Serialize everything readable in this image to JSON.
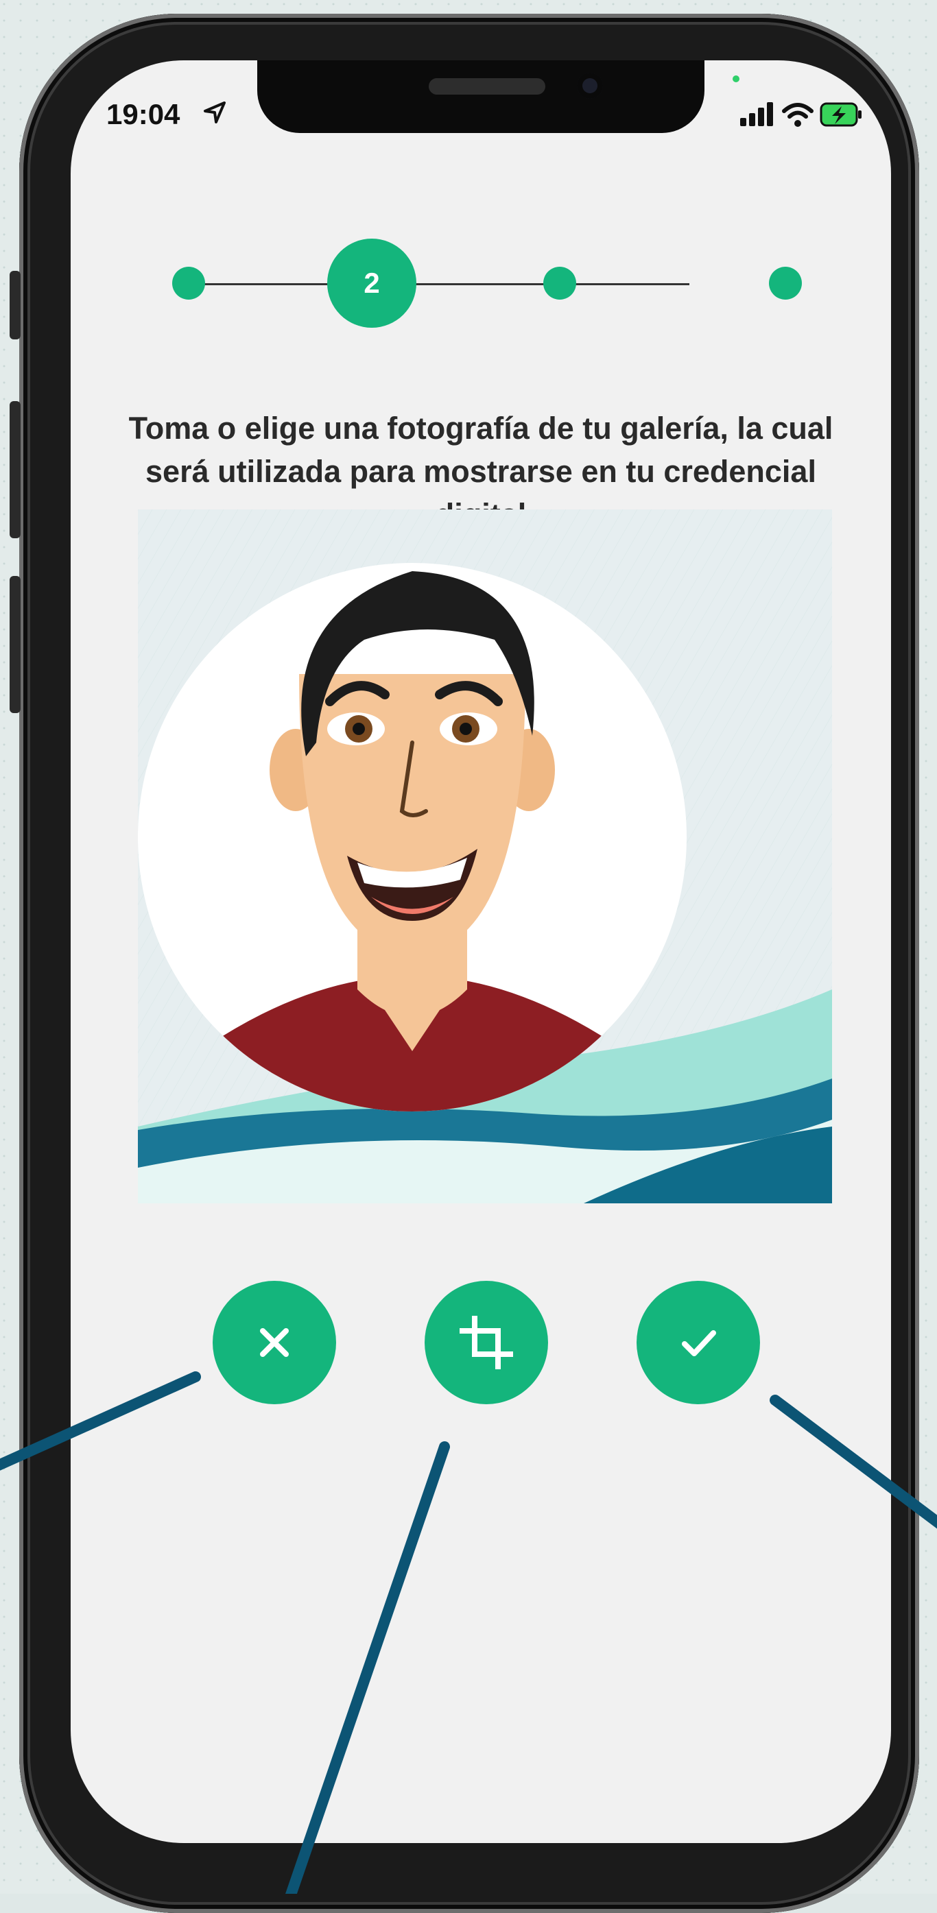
{
  "status_bar": {
    "time": "19:04"
  },
  "stepper": {
    "current_step": "2",
    "total_steps": 4
  },
  "instructions": {
    "text": "Toma o elige una fotografía de tu galería, la cual será utilizada para mostrarse en tu credencial digital"
  },
  "photo": {
    "icon": "avatar-illustration"
  },
  "actions": {
    "cancel_icon": "close-icon",
    "crop_icon": "crop-icon",
    "confirm_icon": "check-icon"
  },
  "colors": {
    "accent": "#14b57c",
    "callout": "#0c5474",
    "screen_bg": "#f1f1f1"
  }
}
